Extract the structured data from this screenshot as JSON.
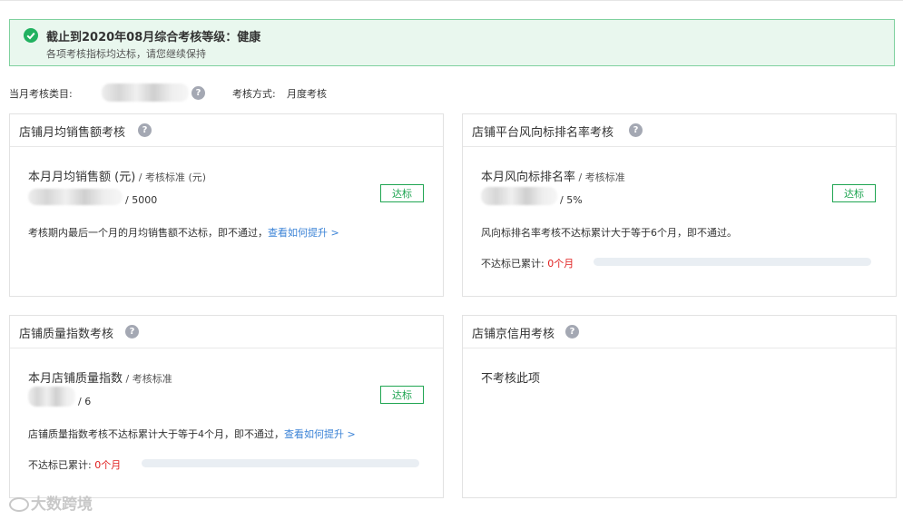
{
  "banner": {
    "title": "截止到2020年08月综合考核等级：健康",
    "subtitle": "各项考核指标均达标，请您继续保持"
  },
  "meta": {
    "category_label": "当月考核类目:",
    "method_label": "考核方式:",
    "method_value": "月度考核"
  },
  "cards": [
    {
      "title": "店铺月均销售额考核",
      "metric": "本月月均销售额 (元)",
      "standard": " / 考核标准 (元)",
      "target": "/ 5000",
      "badge": "达标",
      "note": "考核期内最后一个月的月均销售额不达标，即不通过，",
      "link": "查看如何提升 >"
    },
    {
      "title": "店铺平台风向标排名率考核",
      "metric": "本月风向标排名率",
      "standard": " / 考核标准",
      "target": "/ 5%",
      "badge": "达标",
      "note": "风向标排名率考核不达标累计大于等于6个月，即不通过。",
      "accum_label": "不达标已累计:",
      "accum_value": "0个月",
      "accum_fraction": 0
    },
    {
      "title": "店铺质量指数考核",
      "metric": "本月店铺质量指数",
      "standard": " / 考核标准",
      "target": "/ 6",
      "badge": "达标",
      "note": "店铺质量指数考核不达标累计大于等于4个月，即不通过，",
      "link": "查看如何提升 >",
      "accum_label": "不达标已累计:",
      "accum_value": "0个月",
      "accum_fraction": 0
    },
    {
      "title": "店铺京信用考核",
      "message": "不考核此项"
    }
  ],
  "icons": {
    "check": "check-circle-icon",
    "help": "question-icon"
  },
  "colors": {
    "success": "#21b160",
    "link": "#3a82d6",
    "danger": "#e02020"
  },
  "watermark": "大数跨境"
}
